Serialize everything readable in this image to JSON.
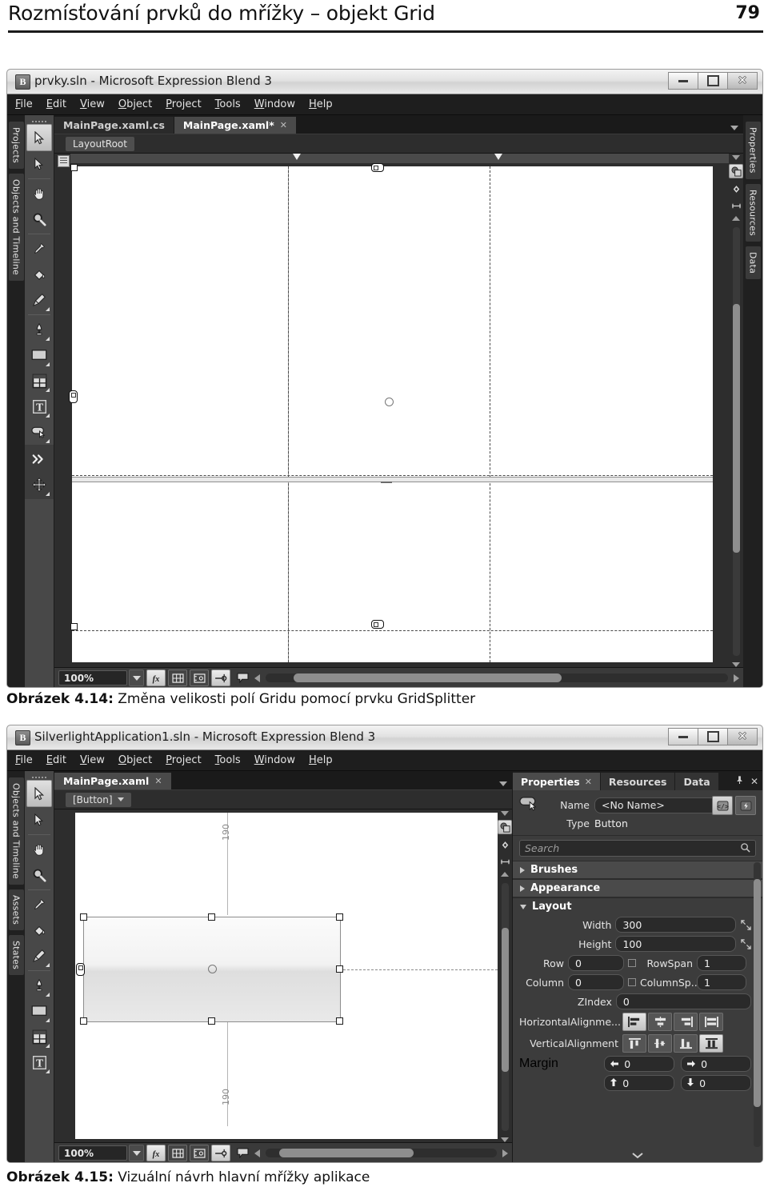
{
  "page": {
    "header_title": "Rozmísťování prvků do mřížky – objekt Grid",
    "page_number": "79"
  },
  "captions": {
    "fig414_label": "Obrázek 4.14:",
    "fig414_text": " Změna velikosti polí Gridu pomocí prvku GridSplitter",
    "fig415_label": "Obrázek 4.15:",
    "fig415_text": " Vizuální návrh hlavní mřížky aplikace"
  },
  "screenshot1": {
    "titlebar": {
      "app_icon": "B",
      "title": "prvky.sln - Microsoft Expression Blend 3",
      "minimize": "minimize-icon",
      "maximize": "maximize-icon",
      "close": "✕"
    },
    "menu": [
      "File",
      "Edit",
      "View",
      "Object",
      "Project",
      "Tools",
      "Window",
      "Help"
    ],
    "left_tabs": [
      "Projects",
      "Objects and Timeline"
    ],
    "right_tabs": [
      "Properties",
      "Resources",
      "Data"
    ],
    "document_tabs": [
      {
        "label": "MainPage.xaml.cs",
        "active": false,
        "close": ""
      },
      {
        "label": "MainPage.xaml*",
        "active": true,
        "close": "✕"
      }
    ],
    "breadcrumb": "LayoutRoot",
    "tools": [
      "selection-arrow-icon",
      "direct-selection-arrow-icon",
      "pan-hand-icon",
      "zoom-magnifier-icon",
      "eyedropper-icon",
      "paint-bucket-icon",
      "brush-icon",
      "pen-icon",
      "rectangle-icon",
      "grid-icon",
      "text-icon",
      "button-control-icon",
      "assets-chevron-icon",
      "move-arrows-icon"
    ],
    "statusbar": {
      "zoom": "100%",
      "zoom_caret": "chevron-down-icon",
      "buttons": [
        "effects-fx-icon",
        "show-grid-icon",
        "snap-to-gridlines-icon",
        "show-handles-icon",
        "annotations-icon"
      ]
    }
  },
  "screenshot2": {
    "titlebar": {
      "app_icon": "B",
      "title": "SilverlightApplication1.sln - Microsoft Expression Blend 3",
      "minimize": "minimize-icon",
      "maximize": "maximize-icon",
      "close": "✕"
    },
    "menu": [
      "File",
      "Edit",
      "View",
      "Object",
      "Project",
      "Tools",
      "Window",
      "Help"
    ],
    "left_tabs": [
      "Objects and Timeline",
      "Assets",
      "States"
    ],
    "document_tabs": [
      {
        "label": "MainPage.xaml",
        "active": true,
        "close": "✕"
      }
    ],
    "breadcrumb": "[Button]",
    "canvas": {
      "guide_top_label": "190",
      "guide_bottom_label": "190"
    },
    "properties": {
      "tabs": [
        {
          "label": "Properties",
          "active": true,
          "close": "✕"
        },
        {
          "label": "Resources",
          "active": false,
          "close": ""
        },
        {
          "label": "Data",
          "active": false,
          "close": ""
        }
      ],
      "pin": "pin-icon",
      "close": "✕",
      "name_label": "Name",
      "name_value": "<No Name>",
      "type_label": "Type",
      "type_value": "Button",
      "search_placeholder": "Search",
      "sections": [
        {
          "label": "Brushes",
          "expanded": false
        },
        {
          "label": "Appearance",
          "expanded": false
        },
        {
          "label": "Layout",
          "expanded": true
        }
      ],
      "layout": {
        "width_label": "Width",
        "width_value": "300",
        "height_label": "Height",
        "height_value": "100",
        "row_label": "Row",
        "row_value": "0",
        "rowspan_label": "RowSpan",
        "rowspan_value": "1",
        "column_label": "Column",
        "column_value": "0",
        "columnspan_label": "ColumnSp...",
        "columnspan_value": "1",
        "zindex_label": "ZIndex",
        "zindex_value": "0",
        "halign_label": "HorizontalAlignme...",
        "halign_options": [
          "align-left-icon",
          "align-center-icon",
          "align-right-icon",
          "align-stretch-icon"
        ],
        "halign_selected": 0,
        "valign_label": "VerticalAlignment",
        "valign_options": [
          "align-top-icon",
          "align-middle-icon",
          "align-bottom-icon",
          "align-vstretch-icon"
        ],
        "valign_selected": 3,
        "margin_label": "Margin",
        "margin_left": "0",
        "margin_right": "0",
        "margin_top": "0",
        "margin_bottom": "0"
      }
    },
    "statusbar": {
      "zoom": "100%",
      "zoom_caret": "chevron-down-icon",
      "buttons": [
        "effects-fx-icon",
        "show-grid-icon",
        "snap-to-gridlines-icon",
        "show-handles-icon",
        "annotations-icon"
      ]
    }
  },
  "colors": {
    "panel_bg": "#3c3c3c",
    "toolbar_bg": "#484848",
    "dark_bg": "#1e1e1e",
    "accent_selected": "#e0e0e0"
  }
}
